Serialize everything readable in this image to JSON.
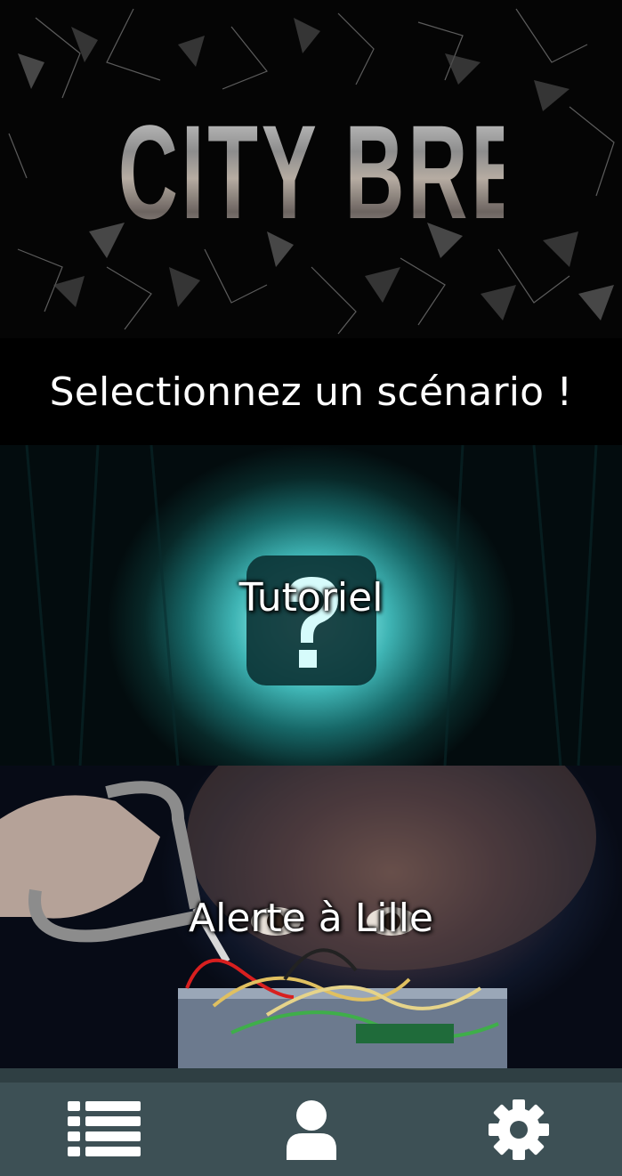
{
  "banner": {
    "title": "CITY BREAK!"
  },
  "prompt": {
    "text": "Selectionnez un scénario !"
  },
  "scenarios": [
    {
      "label": "Tutoriel",
      "icon": "question-mark-icon"
    },
    {
      "label": "Alerte à Lille",
      "icon": "bomb-defusal-image"
    }
  ],
  "nav": {
    "items": [
      {
        "icon": "list-icon"
      },
      {
        "icon": "user-icon"
      },
      {
        "icon": "gear-icon"
      }
    ]
  },
  "colors": {
    "background": "#000000",
    "nav_bar": "#3d5055",
    "nav_bar_border": "#2f3f43",
    "tutorial_glow": "#8ff0ee",
    "text": "#ffffff"
  }
}
